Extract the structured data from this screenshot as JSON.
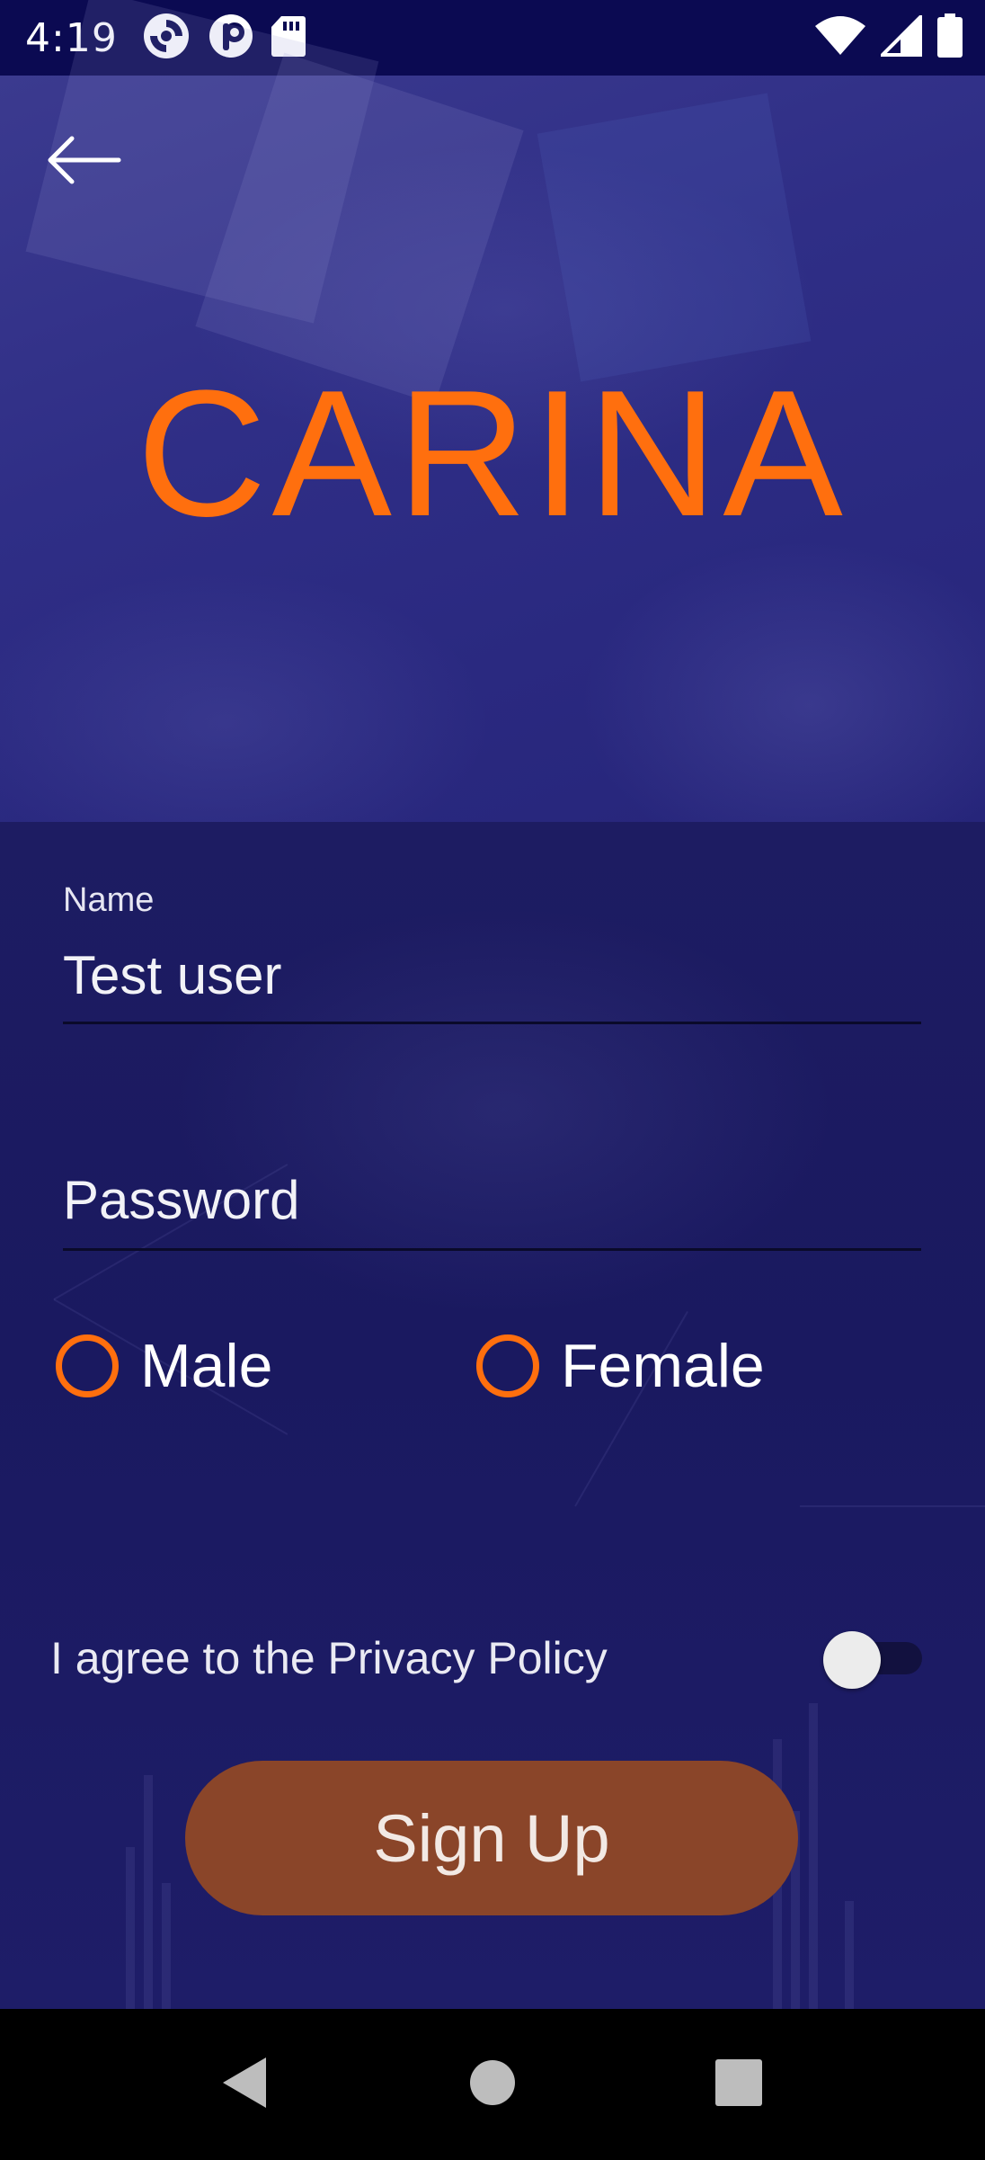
{
  "status_bar": {
    "time": "4:19",
    "left_icons": [
      "sync-icon",
      "pinterest-like-icon",
      "sd-card-icon"
    ],
    "right_icons": [
      "wifi-icon",
      "cell-signal-icon",
      "battery-icon"
    ]
  },
  "header": {
    "back_icon": "arrow-left-icon",
    "logo_text": "CARINA",
    "logo_color": "#ff6f0e"
  },
  "form": {
    "name": {
      "label": "Name",
      "value": "Test user"
    },
    "password": {
      "placeholder": "Password",
      "value": ""
    },
    "gender": {
      "options": [
        "Male",
        "Female"
      ],
      "selected": null
    },
    "privacy": {
      "label": "I agree to the Privacy Policy",
      "checked": false
    },
    "submit_label": "Sign Up",
    "accent_color": "#ff6f0e",
    "button_color": "#8a4529"
  },
  "nav_bar": {
    "icons": [
      "back-triangle-icon",
      "home-circle-icon",
      "recents-square-icon"
    ]
  }
}
